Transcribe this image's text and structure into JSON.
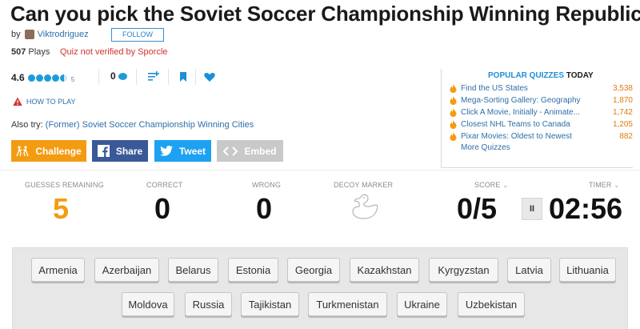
{
  "quiz": {
    "title": "Can you pick the Soviet Soccer Championship Winning Republics?",
    "by_label": "by",
    "author": "Viktrodriguez",
    "follow_label": "FOLLOW",
    "plays_count": "507",
    "plays_label": "Plays",
    "verification_status": "Quiz not verified by Sporcle",
    "rating": "4.6",
    "rating_count": "5",
    "comments_count": "0",
    "how_to_play": "HOW TO PLAY",
    "also_try_label": "Also try:",
    "also_try_link": "(Former) Soviet Soccer Championship Winning Cities"
  },
  "share_buttons": {
    "challenge": "Challenge",
    "share": "Share",
    "tweet": "Tweet",
    "embed": "Embed"
  },
  "popular": {
    "heading": "POPULAR QUIZZES",
    "heading_suffix": "TODAY",
    "items": [
      {
        "name": "Find the US States",
        "count": "3,538"
      },
      {
        "name": "Mega-Sorting Gallery: Geography",
        "count": "1,870"
      },
      {
        "name": "Click A Movie, Initially - Animate...",
        "count": "1,742"
      },
      {
        "name": "Closest NHL Teams to Canada",
        "count": "1,205"
      },
      {
        "name": "Pixar Movies: Oldest to Newest",
        "count": "882"
      }
    ],
    "more": "More Quizzes"
  },
  "stats": {
    "guesses_label": "GUESSES REMAINING",
    "guesses_value": "5",
    "correct_label": "CORRECT",
    "correct_value": "0",
    "wrong_label": "WRONG",
    "wrong_value": "0",
    "decoy_label": "DECOY MARKER",
    "score_label": "SCORE",
    "score_value": "0/5",
    "timer_label": "TIMER",
    "timer_value": "02:56",
    "pause_label": "II"
  },
  "answers": [
    "Armenia",
    "Azerbaijan",
    "Belarus",
    "Estonia",
    "Georgia",
    "Kazakhstan",
    "Kyrgyzstan",
    "Latvia",
    "Lithuania",
    "Moldova",
    "Russia",
    "Tajikistan",
    "Turkmenistan",
    "Ukraine",
    "Uzbekistan"
  ],
  "colors": {
    "accent_orange": "#f39c12",
    "link_blue": "#2d6fa8",
    "icon_blue": "#1d9bd7",
    "facebook": "#3b5998",
    "twitter": "#1da1f2",
    "warning_red": "#d2322d"
  },
  "icons": [
    "avatar",
    "star-dot-icon",
    "comment-icon",
    "add-to-playlist-icon",
    "bookmark-icon",
    "heart-icon",
    "warning-icon",
    "challenge-icon",
    "facebook-icon",
    "twitter-icon",
    "embed-icon",
    "flame-icon",
    "duck-icon",
    "chevron-down-icon",
    "pause-icon"
  ]
}
